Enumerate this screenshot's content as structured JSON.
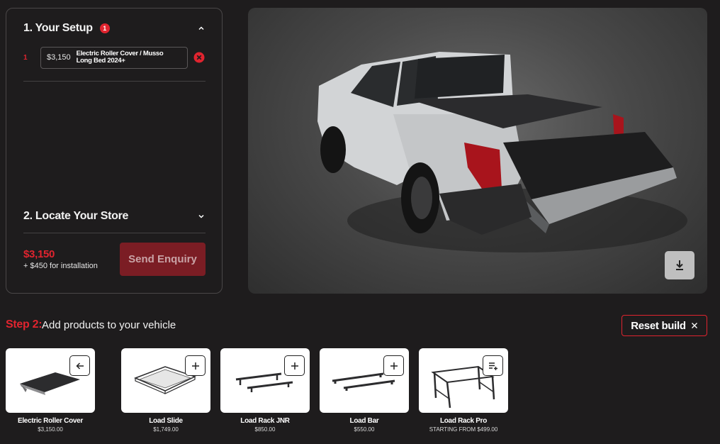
{
  "setup": {
    "section1_title": "1. Your Setup",
    "section1_badge": "1",
    "items": [
      {
        "index": "1",
        "price": "$3,150",
        "name_line1": "Electric Roller Cover / Musso",
        "name_line2": "Long Bed 2024+"
      }
    ],
    "section2_title": "2. Locate Your Store",
    "total_price": "$3,150",
    "install_note": "+ $450 for installation",
    "send_label": "Send Enquiry"
  },
  "step2": {
    "label": "Step 2:",
    "text": "Add products to your vehicle",
    "reset_label": "Reset build"
  },
  "products": [
    {
      "name": "Electric Roller Cover",
      "price": "$3,150.00",
      "action_icon": "back-arrow-icon"
    },
    {
      "name": "Load Slide",
      "price": "$1,749.00",
      "action_icon": "plus-icon"
    },
    {
      "name": "Load Rack JNR",
      "price": "$850.00",
      "action_icon": "plus-icon"
    },
    {
      "name": "Load Bar",
      "price": "$550.00",
      "action_icon": "plus-icon"
    },
    {
      "name": "Load Rack Pro",
      "price": "STARTING FROM $499.00",
      "action_icon": "list-add-icon"
    }
  ],
  "colors": {
    "accent": "#e0242f",
    "background": "#1e1c1d",
    "send_button": "#7b1d24"
  }
}
